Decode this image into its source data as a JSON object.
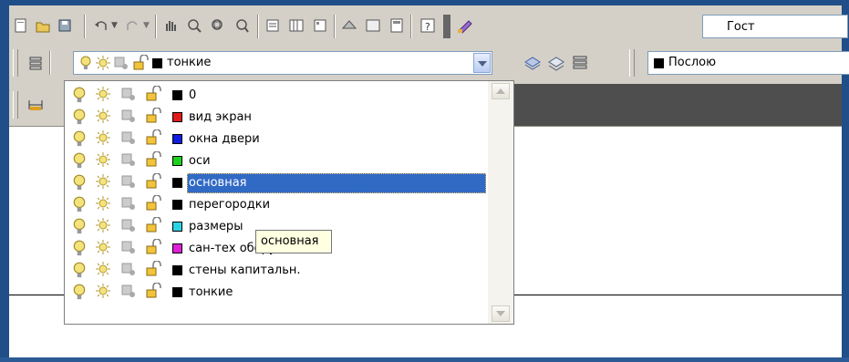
{
  "style_box": {
    "value": "Гост"
  },
  "layer_combo": {
    "current_name": "тонкие",
    "current_color": "#000000"
  },
  "color_box": {
    "value": "Послою",
    "swatch": "#000000"
  },
  "layers": [
    {
      "name": "0",
      "color": "#000000"
    },
    {
      "name": "вид экран",
      "color": "#e31b1b"
    },
    {
      "name": "окна двери",
      "color": "#0d1ee0"
    },
    {
      "name": "оси",
      "color": "#1fd11f"
    },
    {
      "name": "основная",
      "color": "#000000",
      "selected": true
    },
    {
      "name": "перегородки",
      "color": "#000000"
    },
    {
      "name": "размеры",
      "color": "#2ad4e6"
    },
    {
      "name": "сан-тех оборуд",
      "color": "#e020d8"
    },
    {
      "name": "стены капитальн.",
      "color": "#000000"
    },
    {
      "name": "тонкие",
      "color": "#000000"
    }
  ],
  "tooltip": {
    "text": "основная"
  },
  "icons": {
    "bulb": "lightbulb-icon",
    "sun": "sun-freeze-icon",
    "freeze": "viewport-freeze-icon",
    "lock": "padlock-icon"
  },
  "colors": {
    "frame": "#1f4e89",
    "toolbar": "#d4d0c8",
    "highlight": "#316ac5"
  }
}
